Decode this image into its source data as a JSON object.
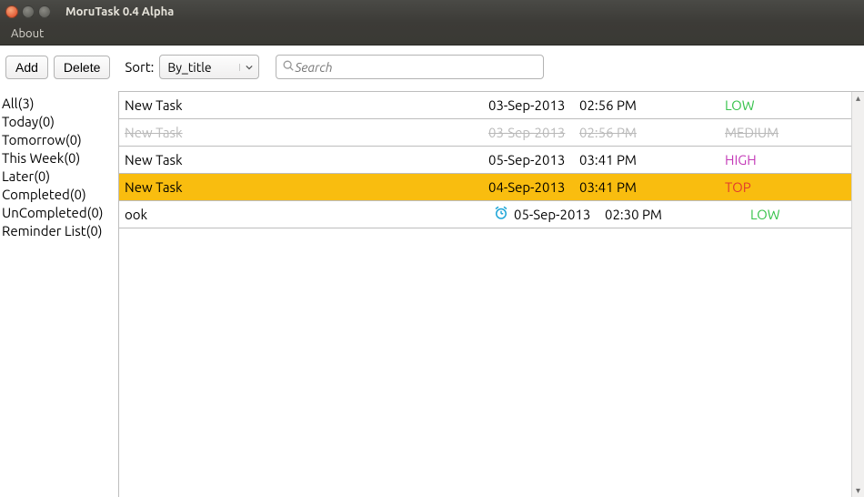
{
  "window": {
    "title": "MoruTask 0.4 Alpha"
  },
  "menu": {
    "about": "About"
  },
  "toolbar": {
    "add_label": "Add",
    "delete_label": "Delete",
    "sort_label": "Sort:",
    "sort_value": "By_title",
    "search_placeholder": "Search"
  },
  "sidebar": {
    "items": [
      {
        "label": "All(3)"
      },
      {
        "label": "Today(0)"
      },
      {
        "label": "Tomorrow(0)"
      },
      {
        "label": "This Week(0)"
      },
      {
        "label": "Later(0)"
      },
      {
        "label": "Completed(0)"
      },
      {
        "label": "UnCompleted(0)"
      },
      {
        "label": "Reminder List(0)"
      }
    ]
  },
  "tasks": {
    "rows": [
      {
        "title": "New Task",
        "date": "03-Sep-2013",
        "time": "02:56 PM",
        "priority": "LOW",
        "prio_class": "prio-low",
        "completed": false,
        "selected": false,
        "reminder": false
      },
      {
        "title": "New Task",
        "date": "03-Sep-2013",
        "time": "02:56 PM",
        "priority": "MEDIUM",
        "prio_class": "prio-med",
        "completed": true,
        "selected": false,
        "reminder": false
      },
      {
        "title": "New Task",
        "date": "05-Sep-2013",
        "time": "03:41 PM",
        "priority": "HIGH",
        "prio_class": "prio-high",
        "completed": false,
        "selected": false,
        "reminder": false
      },
      {
        "title": "New Task",
        "date": "04-Sep-2013",
        "time": "03:41 PM",
        "priority": "TOP",
        "prio_class": "prio-top",
        "completed": false,
        "selected": true,
        "reminder": false
      },
      {
        "title": "ook",
        "date": "05-Sep-2013",
        "time": "02:30 PM",
        "priority": "LOW",
        "prio_class": "prio-low",
        "completed": false,
        "selected": false,
        "reminder": true
      }
    ]
  }
}
